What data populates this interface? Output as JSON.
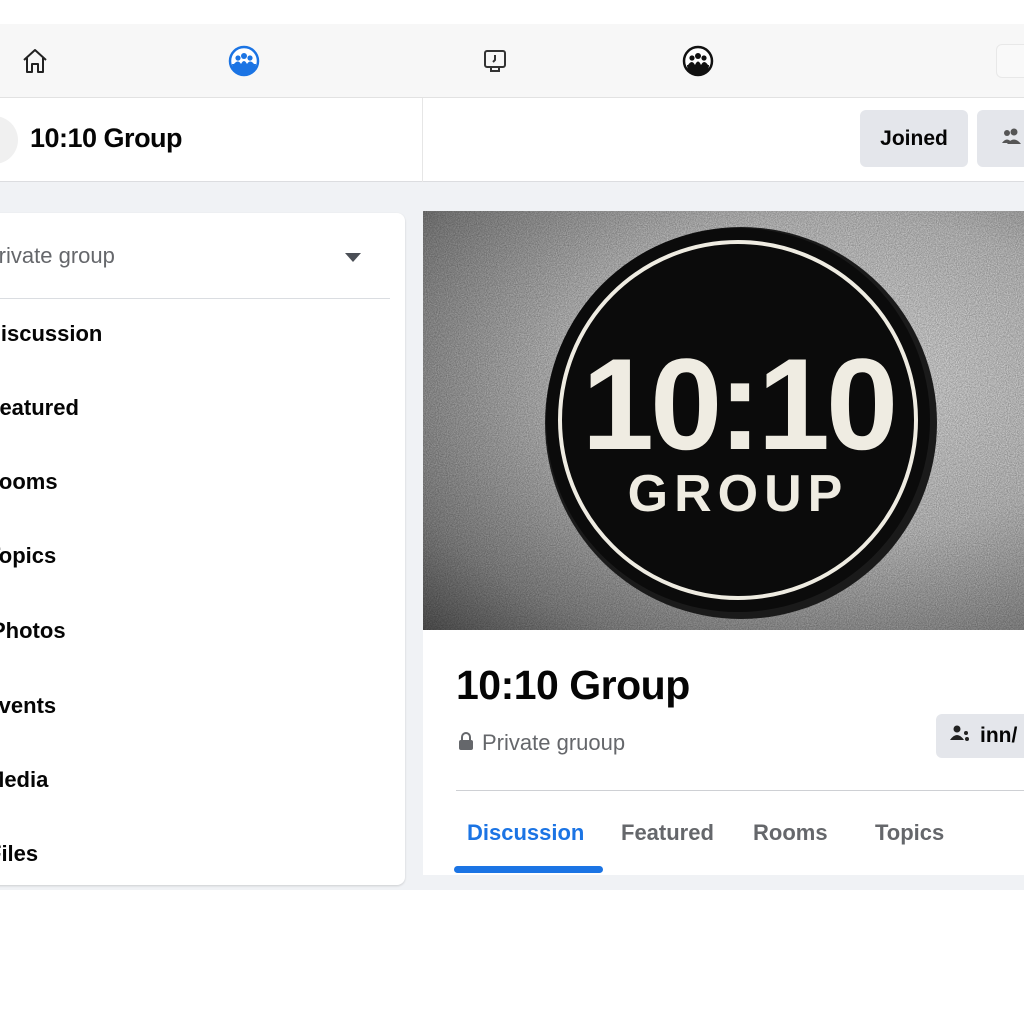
{
  "nav": {
    "icons": [
      "home-icon",
      "groups-icon",
      "watch-icon",
      "community-icon"
    ],
    "accent": "#1b74e4"
  },
  "header": {
    "title": "10:10 Group",
    "joined_label": "Joined"
  },
  "sidebar": {
    "privacy_label": "Private group",
    "items": [
      {
        "label": "Discussion"
      },
      {
        "label": "Featured"
      },
      {
        "label": "Rooms"
      },
      {
        "label": "Topics"
      },
      {
        "label": "Photos"
      },
      {
        "label": "Events"
      },
      {
        "label": "Media"
      },
      {
        "label": "Files"
      }
    ]
  },
  "cover": {
    "logo_line1": "10:10",
    "logo_line2": "GROUP"
  },
  "group": {
    "title": "10:10 Group",
    "privacy": "Private gruoup",
    "invite_label": "inn/"
  },
  "tabs": [
    {
      "label": "Discussion",
      "active": true
    },
    {
      "label": "Featured"
    },
    {
      "label": "Rooms"
    },
    {
      "label": "Topics"
    }
  ]
}
